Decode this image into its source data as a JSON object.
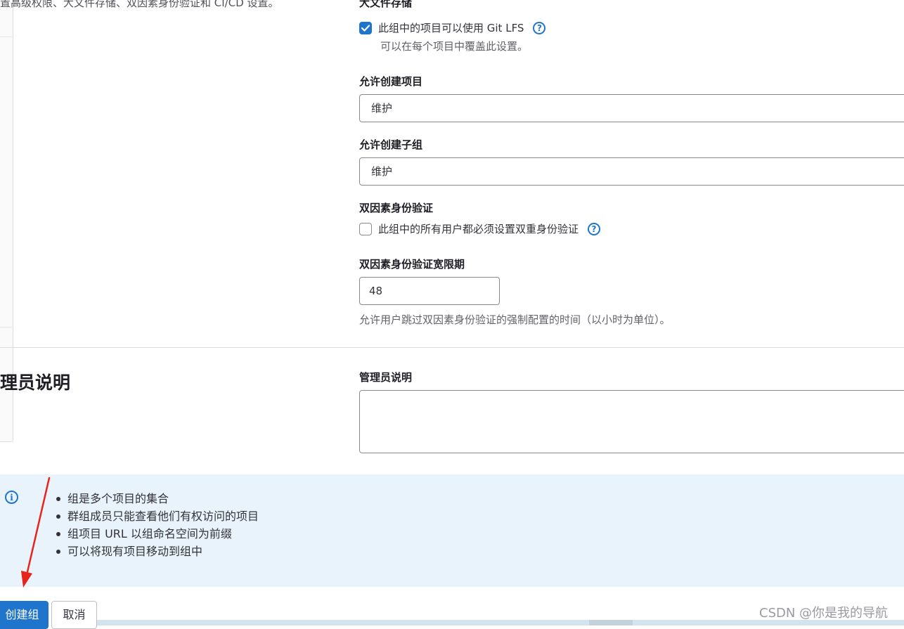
{
  "top_desc": "置高级权限、大文件存储、双因素身份验证和 CI/CD 设置。",
  "lfs": {
    "title": "大文件存储",
    "checkbox_label": "此组中的项目可以使用 Git LFS",
    "checked": true,
    "hint": "可以在每个项目中覆盖此设置。"
  },
  "project_creation": {
    "label": "允许创建项目",
    "value": "维护"
  },
  "subgroup_creation": {
    "label": "允许创建子组",
    "value": "维护"
  },
  "two_factor": {
    "title": "双因素身份验证",
    "checkbox_label": "此组中的所有用户都必须设置双重身份验证",
    "checked": false
  },
  "grace_period": {
    "label": "双因素身份验证宽限期",
    "value": "48",
    "hint": "允许用户跳过双因素身份验证的强制配置的时间（以小时为单位）。"
  },
  "admin_notes": {
    "heading": "理员说明",
    "label": "管理员说明",
    "value": ""
  },
  "info": {
    "items": [
      "组是多个项目的集合",
      "群组成员只能查看他们有权访问的项目",
      "组项目 URL 以组命名空间为前缀",
      "可以将现有项目移动到组中"
    ]
  },
  "actions": {
    "create_label": "创建组",
    "cancel_label": "取消"
  },
  "watermark": "CSDN @你是我的导航",
  "colors": {
    "primary": "#1f75cb",
    "info_bg": "#e9f3fc",
    "annotation_arrow": "#e8231c"
  }
}
